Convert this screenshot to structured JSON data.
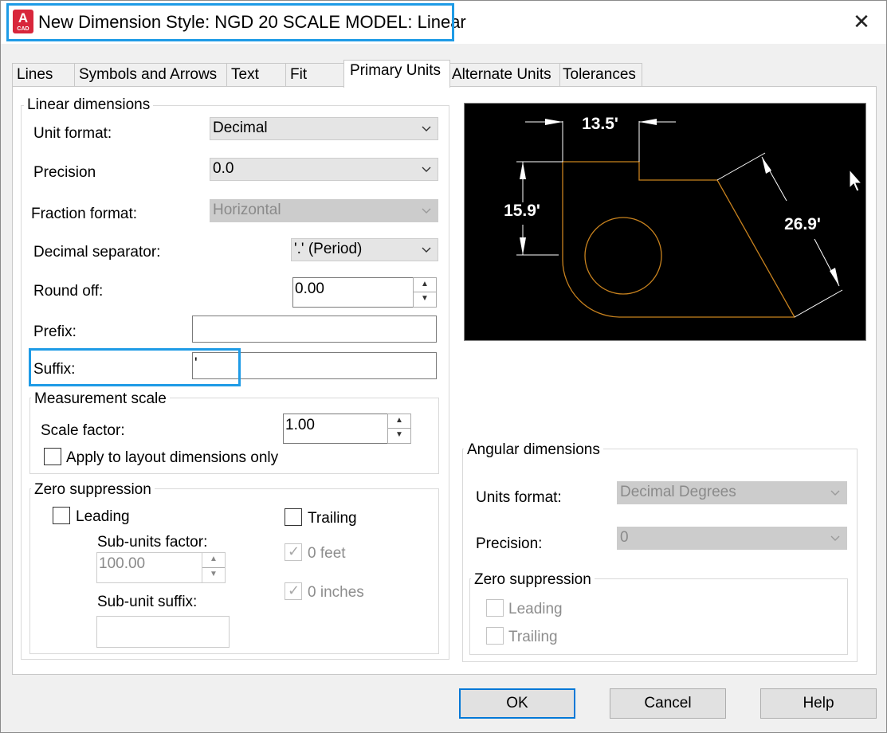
{
  "window": {
    "title": "New Dimension Style: NGD 20 SCALE MODEL: Linear",
    "app_icon_letter": "A",
    "app_icon_sub": "CAD",
    "close_glyph": "✕"
  },
  "tabs": [
    {
      "label": "Lines"
    },
    {
      "label": "Symbols and Arrows"
    },
    {
      "label": "Text"
    },
    {
      "label": "Fit"
    },
    {
      "label": "Primary Units",
      "active": true
    },
    {
      "label": "Alternate Units"
    },
    {
      "label": "Tolerances"
    }
  ],
  "linear": {
    "group_title": "Linear dimensions",
    "unit_format_label": "Unit format:",
    "unit_format_value": "Decimal",
    "precision_label": "Precision",
    "precision_value": "0.0",
    "fraction_format_label": "Fraction format:",
    "fraction_format_value": "Horizontal",
    "decimal_separator_label": "Decimal separator:",
    "decimal_separator_value": "'.' (Period)",
    "round_off_label": "Round off:",
    "round_off_value": "0.00",
    "prefix_label": "Prefix:",
    "prefix_value": "",
    "suffix_label": "Suffix:",
    "suffix_value": "'"
  },
  "measurement_scale": {
    "group_title": "Measurement scale",
    "scale_factor_label": "Scale factor:",
    "scale_factor_value": "1.00",
    "apply_layout_label": "Apply to layout dimensions only",
    "apply_layout_checked": false
  },
  "zero_suppression": {
    "group_title": "Zero suppression",
    "leading_label": "Leading",
    "trailing_label": "Trailing",
    "sub_units_factor_label": "Sub-units factor:",
    "sub_units_factor_value": "100.00",
    "sub_unit_suffix_label": "Sub-unit suffix:",
    "sub_unit_suffix_value": "",
    "feet_label": "0 feet",
    "inches_label": "0 inches",
    "check_glyph": "✓"
  },
  "preview": {
    "dim_top": "13.5'",
    "dim_left": "15.9'",
    "dim_right": "26.9'",
    "background": "#000000",
    "geometry_color": "#c8821e",
    "dimension_color": "#ffffff"
  },
  "angular": {
    "group_title": "Angular dimensions",
    "units_format_label": "Units format:",
    "units_format_value": "Decimal Degrees",
    "precision_label": "Precision:",
    "precision_value": "0",
    "zero_suppression_title": "Zero suppression",
    "leading_label": "Leading",
    "trailing_label": "Trailing"
  },
  "buttons": {
    "ok": "OK",
    "cancel": "Cancel",
    "help": "Help"
  },
  "colors": {
    "highlight": "#1e9be6",
    "focus_border": "#0078d7",
    "app_icon_red": "#d8263b"
  }
}
